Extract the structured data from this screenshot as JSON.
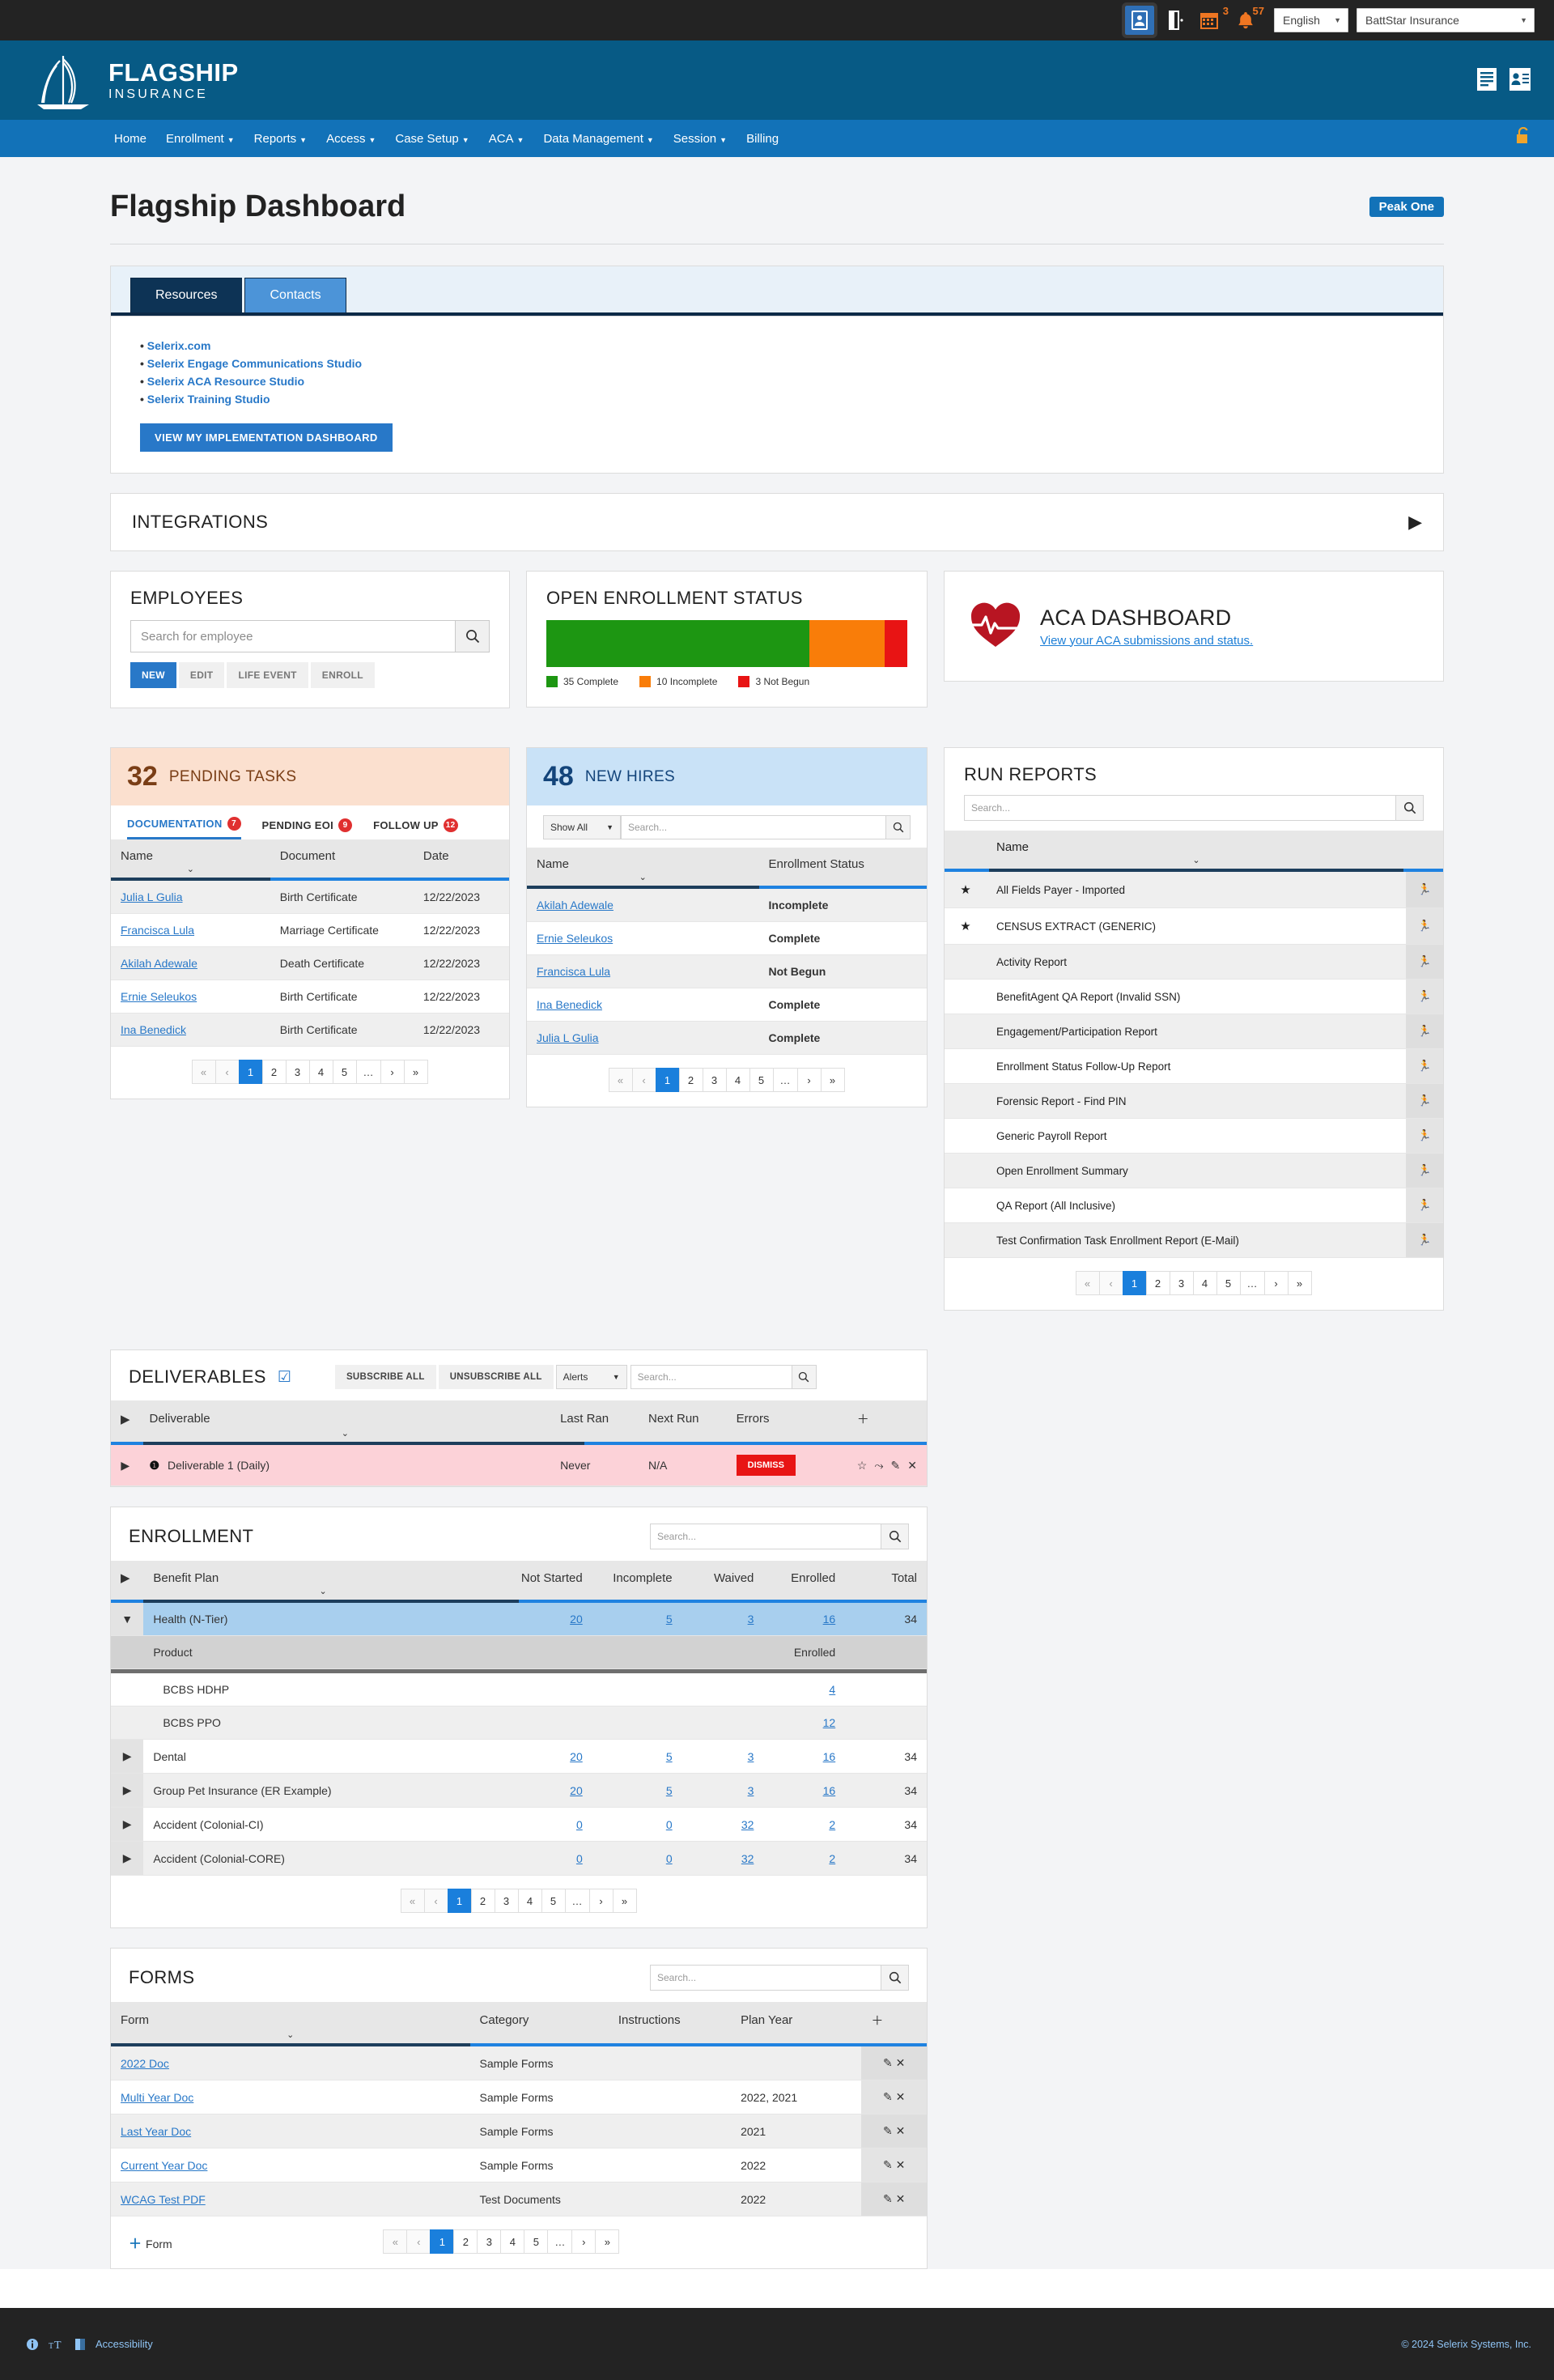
{
  "topbar": {
    "icons": [
      {
        "name": "id-card-icon",
        "glyph": "▯"
      },
      {
        "name": "logout-door-icon",
        "glyph": "⎋"
      },
      {
        "name": "calendar-icon",
        "badge": "3"
      },
      {
        "name": "bell-icon",
        "badge": "57"
      }
    ],
    "language": "English",
    "company": "BattStar Insurance"
  },
  "brand": {
    "line1": "FLAGSHIP",
    "line2": "INSURANCE"
  },
  "nav": {
    "items": [
      {
        "label": "Home",
        "caret": false
      },
      {
        "label": "Enrollment",
        "caret": true
      },
      {
        "label": "Reports",
        "caret": true
      },
      {
        "label": "Access",
        "caret": true
      },
      {
        "label": "Case Setup",
        "caret": true
      },
      {
        "label": "ACA",
        "caret": true
      },
      {
        "label": "Data Management",
        "caret": true
      },
      {
        "label": "Session",
        "caret": true
      },
      {
        "label": "Billing",
        "caret": false
      }
    ]
  },
  "page": {
    "title": "Flagship Dashboard",
    "badge": "Peak One"
  },
  "resources": {
    "tabs": [
      {
        "label": "Resources",
        "active": true
      },
      {
        "label": "Contacts",
        "active": false
      }
    ],
    "links": [
      "Selerix.com",
      "Selerix Engage Communications Studio",
      "Selerix ACA Resource Studio",
      "Selerix Training Studio"
    ],
    "button": "VIEW MY IMPLEMENTATION DASHBOARD"
  },
  "integrations": {
    "title": "INTEGRATIONS",
    "arrow": "▶"
  },
  "employees": {
    "title": "EMPLOYEES",
    "search_placeholder": "Search for employee",
    "search_value": "",
    "buttons": [
      "NEW",
      "EDIT",
      "LIFE EVENT",
      "ENROLL"
    ]
  },
  "open_enrollment": {
    "title": "OPEN ENROLLMENT STATUS"
  },
  "aca": {
    "title": "ACA DASHBOARD",
    "link": "View your ACA submissions and status."
  },
  "pending_tasks": {
    "count": "32",
    "label": "PENDING TASKS",
    "tabs": [
      {
        "label": "DOCUMENTATION",
        "badge": "7",
        "active": true
      },
      {
        "label": "PENDING EOI",
        "badge": "9",
        "active": false
      },
      {
        "label": "FOLLOW UP",
        "badge": "12",
        "active": false
      }
    ],
    "columns": [
      "Name",
      "Document",
      "Date"
    ],
    "rows": [
      {
        "name": "Julia L Gulia",
        "document": "Birth Certificate",
        "date": "12/22/2023"
      },
      {
        "name": "Francisca Lula",
        "document": "Marriage Certificate",
        "date": "12/22/2023"
      },
      {
        "name": "Akilah Adewale",
        "document": "Death Certificate",
        "date": "12/22/2023"
      },
      {
        "name": "Ernie Seleukos",
        "document": "Birth Certificate",
        "date": "12/22/2023"
      },
      {
        "name": "Ina Benedick",
        "document": "Birth Certificate",
        "date": "12/22/2023"
      }
    ],
    "pager": [
      "«",
      "‹",
      "1",
      "2",
      "3",
      "4",
      "5",
      "…",
      "›",
      "»"
    ],
    "pager_active": "1"
  },
  "new_hires": {
    "count": "48",
    "label": "NEW HIRES",
    "filter": "Show All",
    "search_placeholder": "Search...",
    "search_value": "",
    "columns": [
      "Name",
      "Enrollment Status"
    ],
    "rows": [
      {
        "name": "Akilah Adewale",
        "status": "Incomplete",
        "state": "incomplete"
      },
      {
        "name": "Ernie Seleukos",
        "status": "Complete",
        "state": "complete"
      },
      {
        "name": "Francisca Lula",
        "status": "Not Begun",
        "state": "notbegun"
      },
      {
        "name": "Ina Benedick",
        "status": "Complete",
        "state": "complete"
      },
      {
        "name": "Julia L Gulia",
        "status": "Complete",
        "state": "complete"
      }
    ],
    "pager": [
      "«",
      "‹",
      "1",
      "2",
      "3",
      "4",
      "5",
      "…",
      "›",
      "»"
    ],
    "pager_active": "1"
  },
  "run_reports": {
    "title": "RUN REPORTS",
    "search_placeholder": "Search...",
    "search_value": "",
    "column": "Name",
    "rows": [
      {
        "starred": true,
        "name": "All Fields Payer - Imported"
      },
      {
        "starred": true,
        "name": "CENSUS EXTRACT (GENERIC)"
      },
      {
        "starred": false,
        "name": "Activity Report"
      },
      {
        "starred": false,
        "name": "BenefitAgent QA Report (Invalid SSN)"
      },
      {
        "starred": false,
        "name": "Engagement/Participation Report"
      },
      {
        "starred": false,
        "name": "Enrollment Status Follow-Up Report"
      },
      {
        "starred": false,
        "name": "Forensic Report - Find PIN"
      },
      {
        "starred": false,
        "name": "Generic Payroll Report"
      },
      {
        "starred": false,
        "name": "Open Enrollment Summary"
      },
      {
        "starred": false,
        "name": "QA Report (All Inclusive)"
      },
      {
        "starred": false,
        "name": "Test Confirmation Task Enrollment Report (E-Mail)"
      }
    ],
    "pager": [
      "«",
      "‹",
      "1",
      "2",
      "3",
      "4",
      "5",
      "…",
      "›",
      "»"
    ],
    "pager_active": "1"
  },
  "deliverables": {
    "title": "DELIVERABLES",
    "subscribe_all": "SUBSCRIBE ALL",
    "unsubscribe_all": "UNSUBSCRIBE ALL",
    "filter": "Alerts",
    "search_placeholder": "Search...",
    "search_value": "",
    "columns": [
      "Deliverable",
      "Last Ran",
      "Next Run",
      "Errors"
    ],
    "rows": [
      {
        "name": "Deliverable 1 (Daily)",
        "last_ran": "Never",
        "next_run": "N/A",
        "errors": "DISMISS"
      }
    ]
  },
  "enrollment": {
    "title": "ENROLLMENT",
    "search_placeholder": "Search...",
    "search_value": "",
    "columns": [
      "Benefit Plan",
      "Not Started",
      "Incomplete",
      "Waived",
      "Enrolled",
      "Total"
    ],
    "product_columns": [
      "Product",
      "Enrolled"
    ],
    "rows": [
      {
        "plan": "Health (N-Tier)",
        "not_started": "20",
        "incomplete": "5",
        "waived": "3",
        "enrolled": "16",
        "total": "34",
        "expanded": true
      },
      {
        "plan": "Dental",
        "not_started": "20",
        "incomplete": "5",
        "waived": "3",
        "enrolled": "16",
        "total": "34",
        "expanded": false
      },
      {
        "plan": "Group Pet Insurance (ER Example)",
        "not_started": "20",
        "incomplete": "5",
        "waived": "3",
        "enrolled": "16",
        "total": "34",
        "expanded": false
      },
      {
        "plan": "Accident (Colonial-CI)",
        "not_started": "0",
        "incomplete": "0",
        "waived": "32",
        "enrolled": "2",
        "total": "34",
        "expanded": false
      },
      {
        "plan": "Accident (Colonial-CORE)",
        "not_started": "0",
        "incomplete": "0",
        "waived": "32",
        "enrolled": "2",
        "total": "34",
        "expanded": false
      }
    ],
    "products": [
      {
        "name": "BCBS HDHP",
        "enrolled": "4"
      },
      {
        "name": "BCBS PPO",
        "enrolled": "12"
      }
    ],
    "pager": [
      "«",
      "‹",
      "1",
      "2",
      "3",
      "4",
      "5",
      "…",
      "›",
      "»"
    ],
    "pager_active": "1"
  },
  "forms": {
    "title": "FORMS",
    "search_placeholder": "Search...",
    "search_value": "",
    "columns": [
      "Form",
      "Category",
      "Instructions",
      "Plan Year"
    ],
    "rows": [
      {
        "form": "2022 Doc",
        "category": "Sample Forms",
        "instructions": "",
        "plan_year": ""
      },
      {
        "form": "Multi Year Doc",
        "category": "Sample Forms",
        "instructions": "",
        "plan_year": "2022, 2021"
      },
      {
        "form": "Last Year Doc",
        "category": "Sample Forms",
        "instructions": "",
        "plan_year": "2021"
      },
      {
        "form": "Current Year Doc",
        "category": "Sample Forms",
        "instructions": "",
        "plan_year": "2022"
      },
      {
        "form": "WCAG Test PDF",
        "category": "Test Documents",
        "instructions": "",
        "plan_year": "2022"
      }
    ],
    "add_label": "Form",
    "pager": [
      "«",
      "‹",
      "1",
      "2",
      "3",
      "4",
      "5",
      "…",
      "›",
      "»"
    ],
    "pager_active": "1"
  },
  "footer": {
    "accessibility": "Accessibility",
    "copyright": "© 2024 Selerix Systems, Inc."
  },
  "chart_data": {
    "type": "bar",
    "title": "OPEN ENROLLMENT STATUS",
    "orientation": "horizontal-stacked",
    "categories": [
      "Complete",
      "Incomplete",
      "Not Begun"
    ],
    "values": [
      35,
      10,
      3
    ],
    "total": 48,
    "colors": [
      "#1d9612",
      "#f97d09",
      "#e81414"
    ],
    "legend": [
      "35 Complete",
      "10 Incomplete",
      "3 Not Begun"
    ],
    "legend_position": "bottom",
    "grid": false,
    "xlabel": "",
    "ylabel": ""
  }
}
